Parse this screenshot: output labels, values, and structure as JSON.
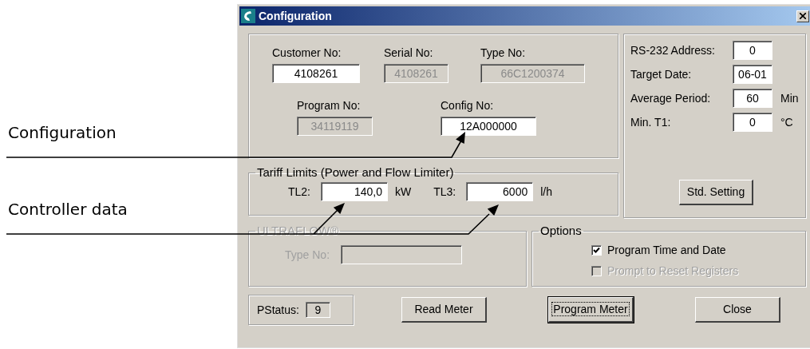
{
  "annotations": [
    {
      "text": "Configuration"
    },
    {
      "text": "Controller data"
    }
  ],
  "window": {
    "title": "Configuration"
  },
  "identification": {
    "rows": [
      [
        {
          "label": "Customer No:",
          "value": "4108261",
          "disabled": false
        },
        {
          "label": "Serial No:",
          "value": "4108261",
          "disabled": true
        },
        {
          "label": "Type No:",
          "value": "66C1200374",
          "disabled": true
        }
      ],
      [
        {
          "label": "Program No:",
          "value": "34119119",
          "disabled": true
        },
        {
          "label": "Config No:",
          "value": "12A000000",
          "disabled": false
        }
      ]
    ]
  },
  "settings": {
    "rows": [
      {
        "label": "RS-232 Address:",
        "value": "0"
      },
      {
        "label": "Target Date:",
        "value": "06-01"
      },
      {
        "label": "Average Period:",
        "value": "60",
        "unit": "Min"
      },
      {
        "label": "Min. T1:",
        "value": "0",
        "unit": "°C"
      }
    ],
    "button": "Std. Setting"
  },
  "tariff": {
    "title": "Tariff Limits (Power and Flow Limiter)",
    "fields": [
      {
        "label": "TL2:",
        "value": "140,0",
        "unit": "kW"
      },
      {
        "label": "TL3:",
        "value": "6000",
        "unit": "l/h"
      }
    ]
  },
  "ultraflow": {
    "title": "ULTRAFLOW®",
    "disabled": true,
    "field_label": "Type No:"
  },
  "options": {
    "title": "Options",
    "items": [
      {
        "label": "Program Time and Date",
        "checked": true,
        "disabled": false
      },
      {
        "label": "Prompt to Reset Registers",
        "checked": false,
        "disabled": true
      }
    ]
  },
  "status": {
    "label": "PStatus:",
    "value": "9"
  },
  "buttons": [
    {
      "label": "Read Meter",
      "default": false
    },
    {
      "label": "Program Meter",
      "default": true
    },
    {
      "label": "Close",
      "default": false
    }
  ]
}
